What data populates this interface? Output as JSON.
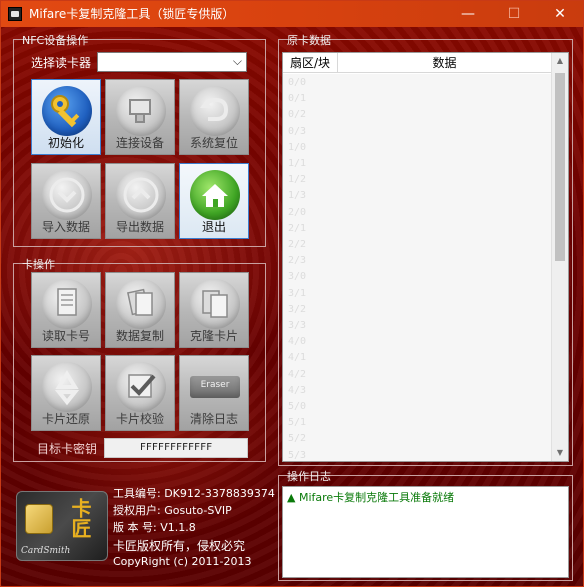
{
  "window": {
    "title": "Mifare卡复制克隆工具（锁匠专供版）",
    "controls": {
      "minimize": "—",
      "maximize": "☐",
      "close": "✕"
    }
  },
  "nfc_group": {
    "title": "NFC设备操作",
    "reader_label": "选择读卡器",
    "reader_value": "",
    "buttons": [
      {
        "label": "初始化",
        "icon": "key-icon",
        "active": true
      },
      {
        "label": "连接设备",
        "icon": "usb-device-icon"
      },
      {
        "label": "系统复位",
        "icon": "undo-icon"
      },
      {
        "label": "导入数据",
        "icon": "chevron-down-icon"
      },
      {
        "label": "导出数据",
        "icon": "chevron-up-icon"
      },
      {
        "label": "退出",
        "icon": "home-icon",
        "active": true
      }
    ]
  },
  "card_group": {
    "title": "卡操作",
    "buttons": [
      {
        "label": "读取卡号",
        "icon": "document-icon"
      },
      {
        "label": "数据复制",
        "icon": "copy-document-icon"
      },
      {
        "label": "克隆卡片",
        "icon": "clone-icon"
      },
      {
        "label": "卡片还原",
        "icon": "recycle-icon"
      },
      {
        "label": "卡片校验",
        "icon": "checkmark-icon"
      },
      {
        "label": "清除日志",
        "icon": "eraser-icon",
        "icon_text": "Eraser"
      }
    ],
    "key_label": "目标卡密钥",
    "key_value": "FFFFFFFFFFFF"
  },
  "raw_data": {
    "title": "原卡数据",
    "columns": [
      "扇区/块",
      "数据"
    ],
    "rows": [
      "0/0",
      "0/1",
      "0/2",
      "0/3",
      "1/0",
      "1/1",
      "1/2",
      "1/3",
      "2/0",
      "2/1",
      "2/2",
      "2/3",
      "3/0",
      "3/1",
      "3/2",
      "3/3",
      "4/0",
      "4/1",
      "4/2",
      "4/3",
      "5/0",
      "5/1",
      "5/2",
      "5/3"
    ]
  },
  "log": {
    "title": "操作日志",
    "entries": [
      "▲ Mifare卡复制克隆工具准备就绪"
    ]
  },
  "info": {
    "logo_text": "卡匠",
    "logo_sub": "CardSmith",
    "tool_id": "工具编号: DK912-3378839374",
    "user": "授权用户: Gosuto-SVIP",
    "version": "版 本 号: V1.1.8",
    "copyright_cn": "卡匠版权所有，侵权必究",
    "copyright_en": "CopyRight (c) 2011-2013"
  },
  "colors": {
    "titlebar": "#e24a12",
    "background": "#7a0000",
    "log_text": "#0a7a0a",
    "active_border": "#3c7fd0"
  }
}
